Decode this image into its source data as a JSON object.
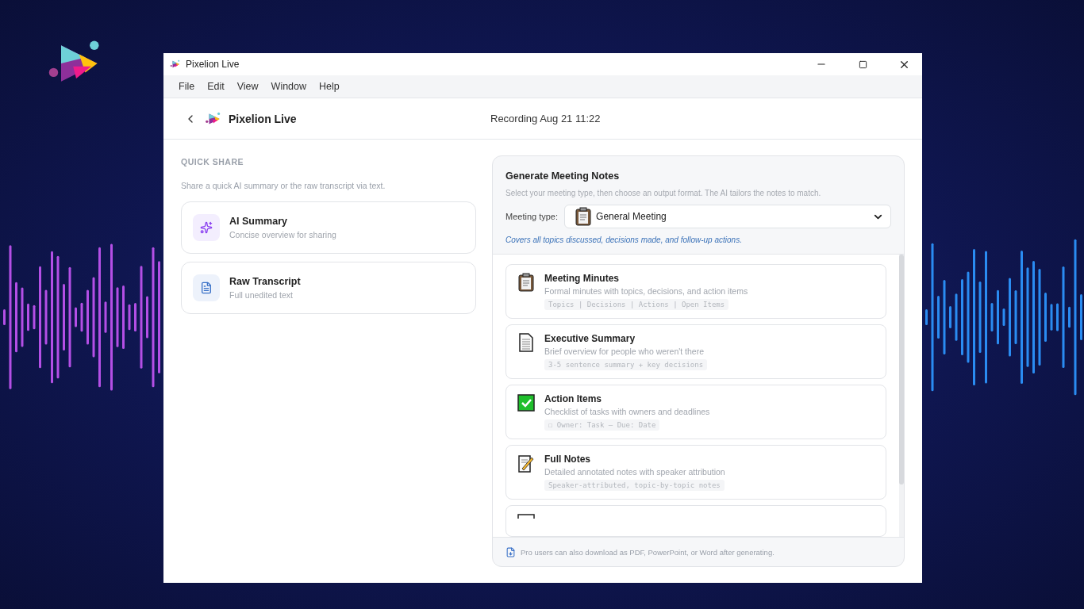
{
  "window": {
    "title": "Pixelion Live"
  },
  "menu": [
    "File",
    "Edit",
    "View",
    "Window",
    "Help"
  ],
  "header": {
    "app_name": "Pixelion Live",
    "recording": "Recording Aug 21 11:22"
  },
  "quick_share": {
    "heading": "QUICK SHARE",
    "description": "Share a quick AI summary or the raw transcript via text.",
    "options": [
      {
        "kind": "sparkle",
        "title": "AI Summary",
        "subtitle": "Concise overview for sharing"
      },
      {
        "kind": "document",
        "title": "Raw Transcript",
        "subtitle": "Full unedited text"
      }
    ]
  },
  "notes": {
    "title": "Generate Meeting Notes",
    "description": "Select your meeting type, then choose an output format. The AI tailors the notes to match.",
    "meeting_type_label": "Meeting type:",
    "meeting_type_value": "General Meeting",
    "hint": "Covers all topics discussed, decisions made, and follow-up actions.",
    "formats": [
      {
        "kind": "clipboard",
        "title": "Meeting Minutes",
        "description": "Formal minutes with topics, decisions, and action items",
        "sample": "Topics | Decisions | Actions | Open Items"
      },
      {
        "kind": "page",
        "title": "Executive Summary",
        "description": "Brief overview for people who weren't there",
        "sample": "3-5 sentence summary + key decisions"
      },
      {
        "kind": "check",
        "title": "Action Items",
        "description": "Checklist of tasks with owners and deadlines",
        "sample": "☐ Owner: Task — Due: Date"
      },
      {
        "kind": "memo",
        "title": "Full Notes",
        "description": "Detailed annotated notes with speaker attribution",
        "sample": "Speaker-attributed, topic-by-topic notes"
      },
      {
        "kind": "clipped"
      }
    ],
    "footer": "Pro users can also download as PDF, PowerPoint, or Word after generating."
  }
}
